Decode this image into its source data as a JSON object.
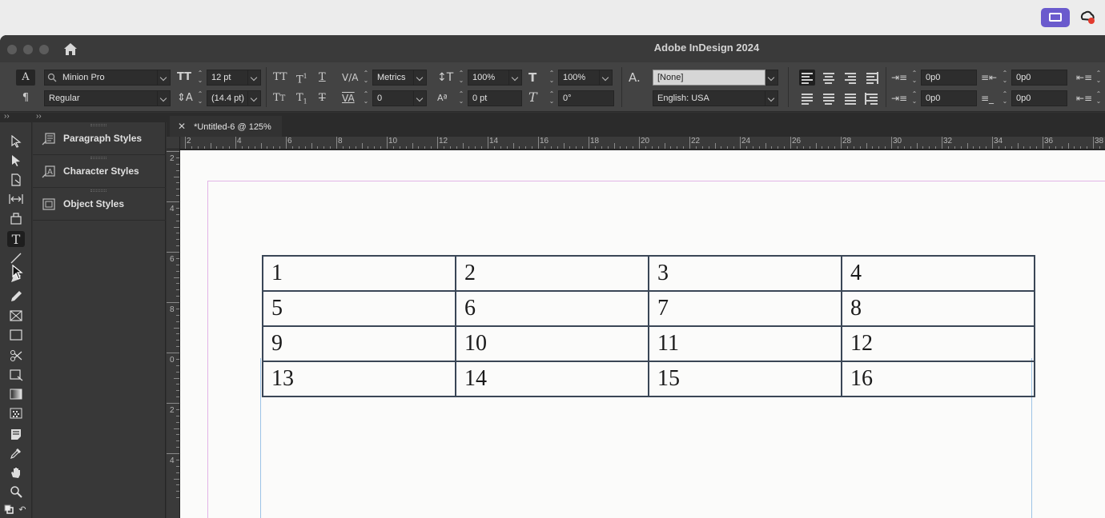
{
  "app": {
    "title": "Adobe InDesign 2024"
  },
  "control_panel": {
    "font_family": "Minion Pro",
    "font_style": "Regular",
    "font_size": "12 pt",
    "leading": "(14.4 pt)",
    "kerning": "Metrics",
    "tracking": "0",
    "vertical_scale": "100%",
    "horizontal_scale": "100%",
    "baseline_shift": "0 pt",
    "skew": "0°",
    "char_style": "[None]",
    "language": "English: USA",
    "left_indent": "0p0",
    "right_indent": "0p0",
    "first_line_indent": "0p0",
    "last_line_indent": "0p0"
  },
  "styles_panel": {
    "items": [
      {
        "label": "Paragraph Styles"
      },
      {
        "label": "Character Styles"
      },
      {
        "label": "Object Styles"
      }
    ]
  },
  "document": {
    "tab_title": "*Untitled-6 @ 125%",
    "table": [
      [
        "1",
        "2",
        "3",
        "4"
      ],
      [
        "5",
        "6",
        "7",
        "8"
      ],
      [
        "9",
        "10",
        "11",
        "12"
      ],
      [
        "13",
        "14",
        "15",
        "16"
      ]
    ]
  },
  "rulers": {
    "horizontal": [
      "2",
      "4",
      "6",
      "8",
      "10",
      "12",
      "14",
      "16",
      "18",
      "20",
      "22",
      "24",
      "26",
      "28",
      "30",
      "32",
      "34",
      "36",
      "38"
    ],
    "vertical": [
      "2",
      "4",
      "6",
      "8",
      "0",
      "2",
      "4"
    ]
  },
  "colors": {
    "accent_screen_share": "#6a5acd",
    "table_border": "#3a4656",
    "margin_guide": "#e2b4e6",
    "frame_edge": "#9dc3e6"
  }
}
